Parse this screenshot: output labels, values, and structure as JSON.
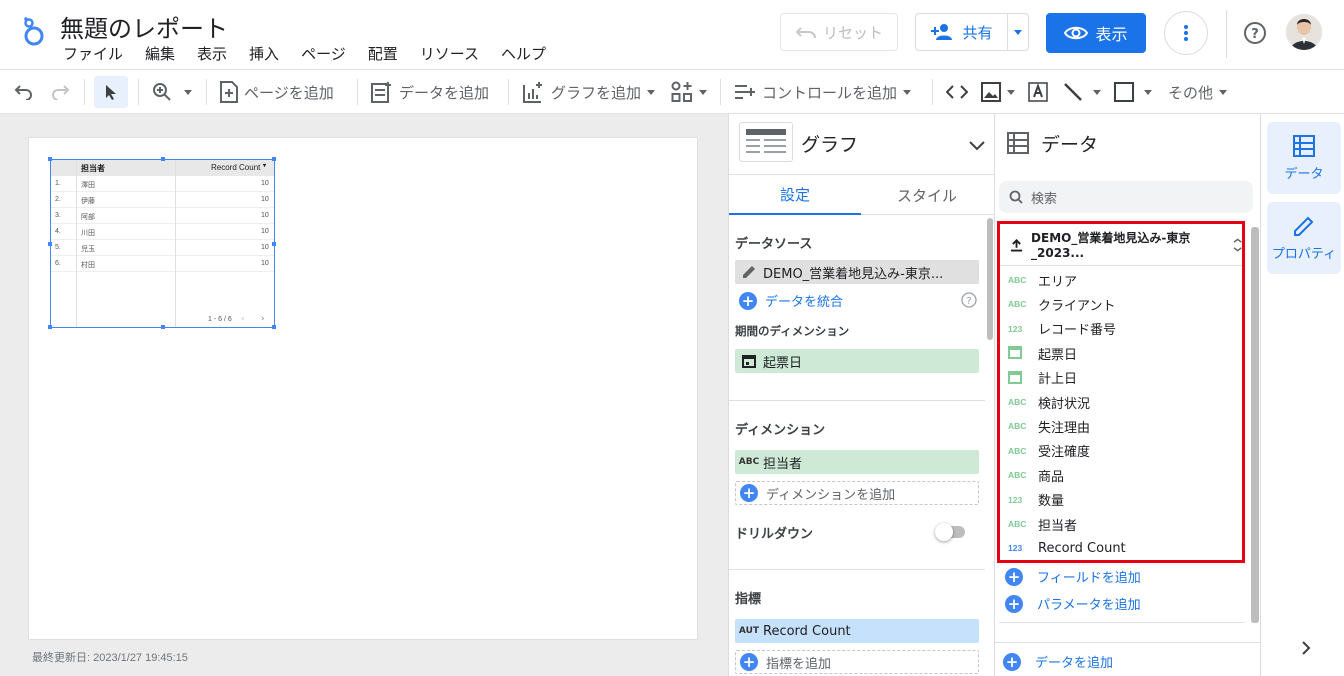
{
  "header": {
    "title": "無題のレポート",
    "menu": [
      "ファイル",
      "編集",
      "表示",
      "挿入",
      "ページ",
      "配置",
      "リソース",
      "ヘルプ"
    ],
    "reset_label": "リセット",
    "share_label": "共有",
    "view_label": "表示"
  },
  "toolbar": {
    "add_page": "ページを追加",
    "add_data": "データを追加",
    "add_chart": "グラフを追加",
    "add_control": "コントロールを追加",
    "more": "その他"
  },
  "canvas": {
    "last_updated": "最終更新日: 2023/1/27 19:45:15",
    "table": {
      "headers": [
        "担当者",
        "Record Count"
      ],
      "rows": [
        {
          "num": "1.",
          "name": "澤田",
          "count": "10"
        },
        {
          "num": "2.",
          "name": "伊藤",
          "count": "10"
        },
        {
          "num": "3.",
          "name": "阿部",
          "count": "10"
        },
        {
          "num": "4.",
          "name": "川田",
          "count": "10"
        },
        {
          "num": "5.",
          "name": "児玉",
          "count": "10"
        },
        {
          "num": "6.",
          "name": "村田",
          "count": "10"
        }
      ],
      "pagination": "1 - 6 / 6"
    }
  },
  "graph_panel": {
    "title": "グラフ",
    "tabs": [
      "設定",
      "スタイル"
    ],
    "data_source_label": "データソース",
    "data_source_value": "DEMO_営業着地見込み-東京...",
    "blend_data": "データを統合",
    "date_dimension_label": "期間のディメンション",
    "date_dimension_value": "起票日",
    "dimension_label": "ディメンション",
    "dimension_type": "ABC",
    "dimension_value": "担当者",
    "add_dimension": "ディメンションを追加",
    "drilldown_label": "ドリルダウン",
    "metric_label": "指標",
    "metric_type": "AUT",
    "metric_value": "Record Count",
    "add_metric": "指標を追加"
  },
  "data_panel": {
    "title": "データ",
    "search_placeholder": "検索",
    "data_source_name": "DEMO_営業着地見込み-東京_2023...",
    "fields": [
      {
        "type": "ABC",
        "name": "エリア"
      },
      {
        "type": "ABC",
        "name": "クライアント"
      },
      {
        "type": "123",
        "name": "レコード番号"
      },
      {
        "type": "date",
        "name": "起票日"
      },
      {
        "type": "date",
        "name": "計上日"
      },
      {
        "type": "ABC",
        "name": "検討状況"
      },
      {
        "type": "ABC",
        "name": "失注理由"
      },
      {
        "type": "ABC",
        "name": "受注確度"
      },
      {
        "type": "ABC",
        "name": "商品"
      },
      {
        "type": "123",
        "name": "数量"
      },
      {
        "type": "ABC",
        "name": "担当者"
      },
      {
        "type": "123",
        "name": "Record Count"
      }
    ],
    "add_field": "フィールドを追加",
    "add_parameter": "パラメータを追加",
    "add_data": "データを追加"
  },
  "right_rail": {
    "data": "データ",
    "properties": "プロパティ"
  }
}
